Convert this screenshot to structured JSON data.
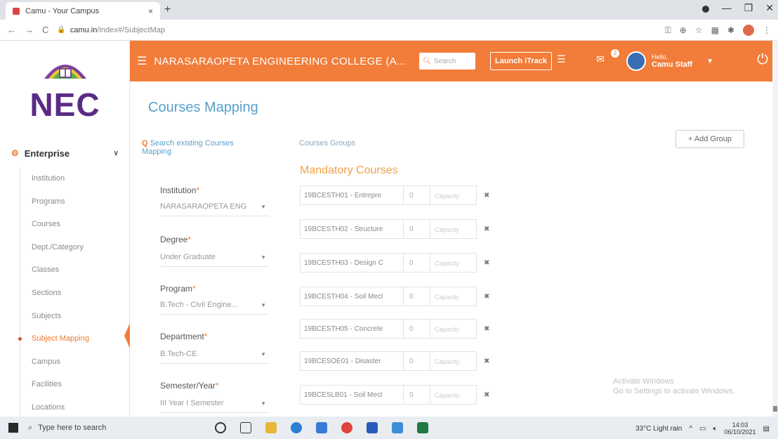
{
  "browser": {
    "tab_title": "Camu - Your Campus",
    "tab_close": "×",
    "new_tab": "+",
    "url_domain": "camu.in",
    "url_path": "/index#/SubjectMap"
  },
  "header": {
    "college": "NARASARAOPETA ENGINEERING COLLEGE (A...",
    "search_placeholder": "Search",
    "launch_track": "Launch iTrack",
    "mail_badge": "2",
    "greeting": "Hello,",
    "user_name": "Camu Staff"
  },
  "logo": {
    "text": "NEC"
  },
  "sidebar": {
    "section": "Enterprise",
    "items": [
      {
        "label": "Institution"
      },
      {
        "label": "Programs"
      },
      {
        "label": "Courses"
      },
      {
        "label": "Dept./Category"
      },
      {
        "label": "Classes"
      },
      {
        "label": "Sections"
      },
      {
        "label": "Subjects"
      },
      {
        "label": "Subject Mapping",
        "active": true
      },
      {
        "label": "Campus"
      },
      {
        "label": "Facilities"
      },
      {
        "label": "Locations"
      }
    ]
  },
  "main": {
    "title": "Courses Mapping",
    "search_link": "Search existing Courses Mapping",
    "groups_label": "Courses Groups",
    "add_group": "+ Add Group",
    "mandatory_label": "Mandatory Courses",
    "form": {
      "institution_label": "Institution",
      "institution_value": "NARASARAOPETA ENG",
      "degree_label": "Degree",
      "degree_value": "Under Graduate",
      "program_label": "Program",
      "program_value": "B.Tech - Civil Engine...",
      "department_label": "Department",
      "department_value": "B.Tech-CE",
      "semester_label": "Semester/Year",
      "semester_value": "III Year I Semester",
      "required_mark": "*"
    },
    "courses": [
      {
        "name": "19BCESTH01 - Entrepre",
        "num": "0",
        "cap": "Capacity"
      },
      {
        "name": "19BCESTH02 - Structure",
        "num": "0",
        "cap": "Capacity"
      },
      {
        "name": "19BCESTH03 - Design C",
        "num": "0",
        "cap": "Capacity"
      },
      {
        "name": "19BCESTH04 - Soil Mecl",
        "num": "0",
        "cap": "Capacity"
      },
      {
        "name": "19BCESTH05 - Concrete",
        "num": "0",
        "cap": "Capacity"
      },
      {
        "name": "19BCESOE01 - Disaster",
        "num": "0",
        "cap": "Capacity"
      },
      {
        "name": "19BCESLB01 - Soil Mecl",
        "num": "0",
        "cap": "Capacity"
      }
    ],
    "delete_glyph": "✖",
    "watermark_line1": "Activate Windows",
    "watermark_line2": "Go to Settings to activate Windows."
  },
  "taskbar": {
    "search_placeholder": "Type here to search",
    "weather": "33°C Light rain",
    "time": "14:03",
    "date": "06/10/2021"
  },
  "colors": {
    "header": "#f27c39",
    "title": "#5aa0c8",
    "logo": "#5b2a86",
    "mandatory": "#f2a24b"
  }
}
